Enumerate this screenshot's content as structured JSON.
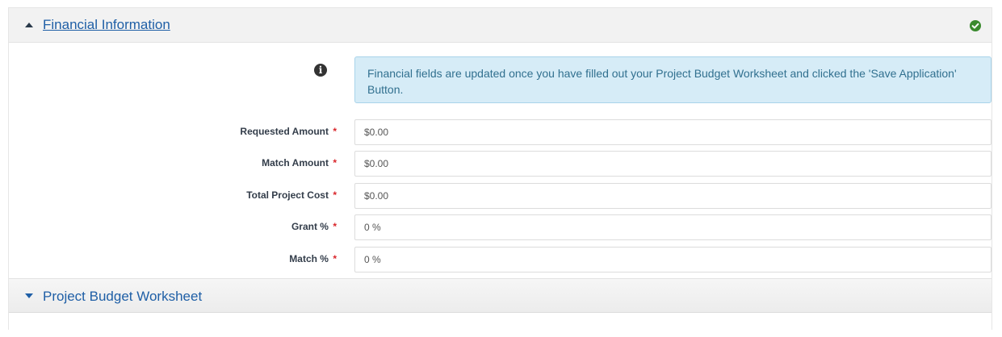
{
  "section": {
    "title": "Financial Information",
    "caret_icon": "caret-up-icon",
    "status_icon": "check-circle-icon",
    "status_color": "#3a8a2e"
  },
  "info": {
    "icon": "info-circle-icon",
    "message": "Financial fields are updated once you have filled out your Project Budget Worksheet and clicked the 'Save Application' Button."
  },
  "fields": [
    {
      "label": "Requested Amount",
      "required": "*",
      "value": "$0.00"
    },
    {
      "label": "Match Amount",
      "required": "*",
      "value": "$0.00"
    },
    {
      "label": "Total Project Cost",
      "required": "*",
      "value": "$0.00"
    },
    {
      "label": "Grant %",
      "required": "*",
      "value": "0 %"
    },
    {
      "label": "Match %",
      "required": "*",
      "value": "0 %"
    }
  ],
  "budget_section": {
    "title": "Project Budget Worksheet",
    "caret_icon": "caret-down-icon"
  },
  "colors": {
    "link": "#1f5fa6",
    "alert_bg": "#d6ecf7",
    "alert_text": "#31708f",
    "required": "#d9262b"
  }
}
